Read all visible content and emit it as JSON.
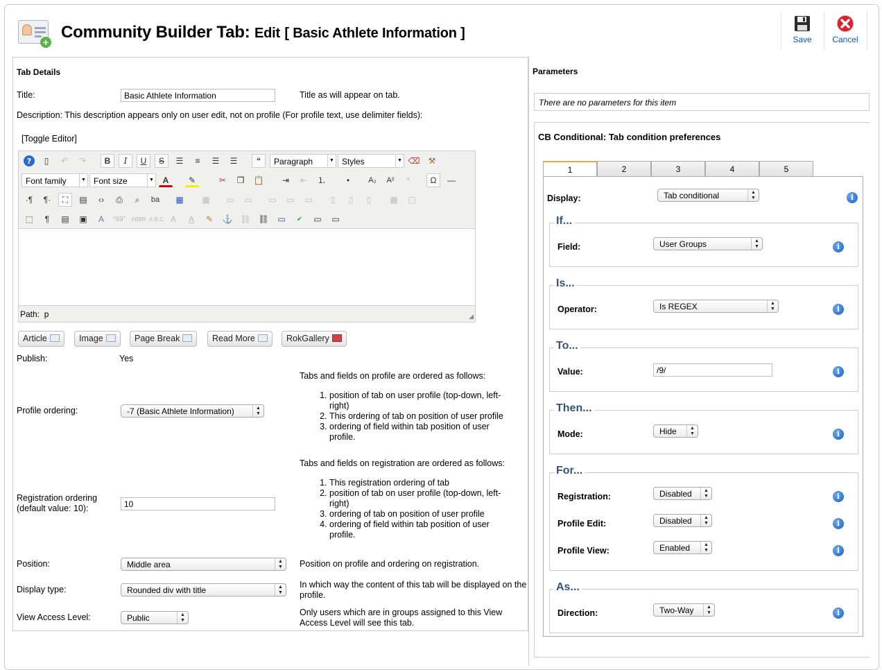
{
  "header": {
    "title_main": "Community Builder Tab:",
    "title_edit": "Edit",
    "title_item": "[ Basic Athlete Information ]",
    "save_label": "Save",
    "cancel_label": "Cancel"
  },
  "left": {
    "section_title": "Tab Details",
    "title_label": "Title:",
    "title_value": "Basic Athlete Information",
    "title_help": "Title as will appear on tab.",
    "description_text": "Description: This description appears only on user edit, not on profile (For profile text, use delimiter fields):",
    "toggle_editor": "[Toggle Editor]",
    "format_select": "Paragraph",
    "styles_select": "Styles",
    "font_family_select": "Font family",
    "font_size_select": "Font size",
    "path_label": "Path:",
    "path_value": "p",
    "buttons": {
      "article": "Article",
      "image": "Image",
      "page_break": "Page Break",
      "read_more": "Read More",
      "rokgallery": "RokGallery"
    },
    "publish_label": "Publish:",
    "publish_value": "Yes",
    "profile_order_intro": "Tabs and fields on profile are ordered as follows:",
    "profile_order_items": [
      "position of tab on user profile (top-down, left-right)",
      "This ordering of tab on position of user profile",
      "ordering of field within tab position of user profile."
    ],
    "profile_ordering_label": "Profile ordering:",
    "profile_ordering_value": "-7 (Basic Athlete Information)",
    "reg_order_intro": "Tabs and fields on registration are ordered as follows:",
    "reg_order_items": [
      "This registration ordering of tab",
      "position of tab on user profile (top-down, left-right)",
      "ordering of tab on position of user profile",
      "ordering of field within tab position of user profile."
    ],
    "reg_ordering_label": "Registration ordering (default value: 10):",
    "reg_ordering_value": "10",
    "position_label": "Position:",
    "position_value": "Middle area",
    "position_help": "Position on profile and ordering on registration.",
    "display_type_label": "Display type:",
    "display_type_value": "Rounded div with title",
    "display_type_help": "In which way the content of this tab will be displayed on the profile.",
    "access_label": "View Access Level:",
    "access_value": "Public",
    "access_help": "Only users which are in groups assigned to this View Access Level will see this tab."
  },
  "right": {
    "section_title": "Parameters",
    "no_params": "There are no parameters for this item",
    "cb_title": "CB Conditional: Tab condition preferences",
    "tabs": [
      "1",
      "2",
      "3",
      "4",
      "5"
    ],
    "display_label": "Display:",
    "display_value": "Tab conditional",
    "if_legend": "If...",
    "field_label": "Field:",
    "field_value": "User Groups",
    "is_legend": "Is...",
    "operator_label": "Operator:",
    "operator_value": "Is REGEX",
    "to_legend": "To...",
    "value_label": "Value:",
    "value_value": "/9/",
    "then_legend": "Then...",
    "mode_label": "Mode:",
    "mode_value": "Hide",
    "for_legend": "For...",
    "registration_label": "Registration:",
    "registration_value": "Disabled",
    "profile_edit_label": "Profile Edit:",
    "profile_edit_value": "Disabled",
    "profile_view_label": "Profile View:",
    "profile_view_value": "Enabled",
    "as_legend": "As...",
    "direction_label": "Direction:",
    "direction_value": "Two-Way"
  },
  "icons": {
    "save": "floppy-disk-icon",
    "cancel": "red-x-icon",
    "info": "info-icon"
  }
}
